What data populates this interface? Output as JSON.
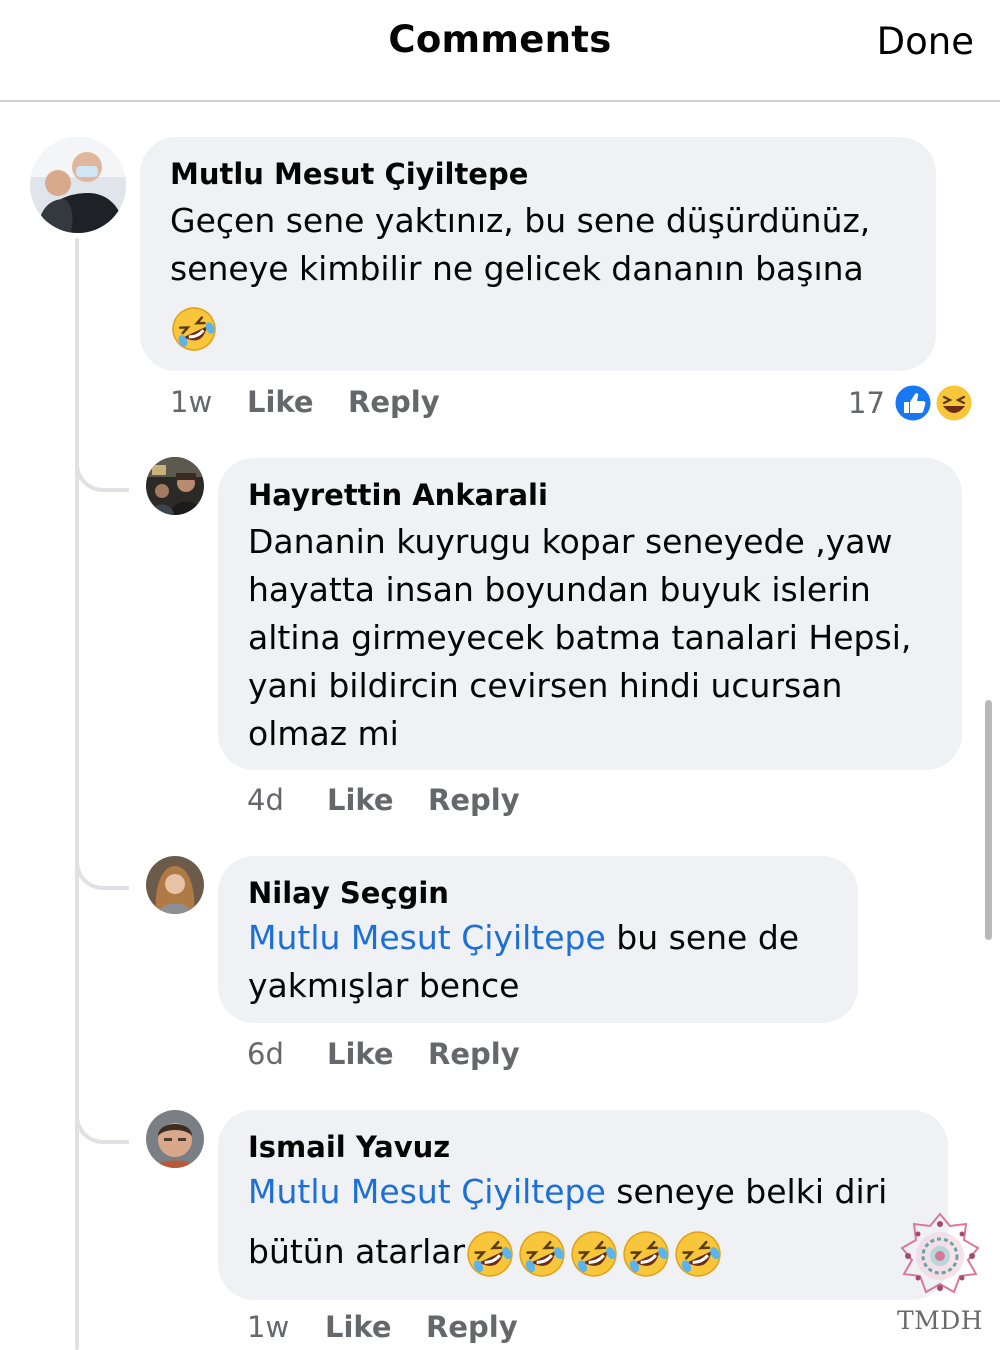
{
  "header": {
    "title": "Comments",
    "done_label": "Done"
  },
  "comments": [
    {
      "author": "Mutlu Mesut Çiyiltepe",
      "lines": [
        "Geçen sene yaktınız, bu sene düşürdünüz,",
        "seneye kimbilir ne gelicek dananın başına"
      ],
      "emoji": "rolling-on-the-floor-laughing",
      "time": "1w",
      "like": "Like",
      "reply": "Reply",
      "reactions": {
        "count": "17",
        "types": [
          "like",
          "laugh"
        ]
      }
    },
    {
      "author": "Hayrettin Ankarali",
      "lines": [
        "Dananin kuyrugu kopar seneyede ,yaw",
        "hayatta insan boyundan buyuk islerin",
        "altina girmeyecek batma tanalari Hepsi,",
        "yani bildircin cevirsen hindi ucursan",
        "olmaz mi"
      ],
      "time": "4d",
      "like": "Like",
      "reply": "Reply"
    },
    {
      "author": "Nilay Seçgin",
      "mention": "Mutlu Mesut Çiyiltepe",
      "line1_rest": " bu sene de",
      "line2": "yakmışlar bence",
      "time": "6d",
      "like": "Like",
      "reply": "Reply"
    },
    {
      "author": "Ismail Yavuz",
      "mention": "Mutlu Mesut Çiyiltepe",
      "line1_rest": " seneye belki diri",
      "line2": "bütün atarlar",
      "emoji": "rolling-on-the-floor-laughing",
      "emoji_count": 5,
      "time": "1w",
      "like": "Like",
      "reply": "Reply"
    }
  ],
  "watermark": {
    "text": "TMDH"
  },
  "colors": {
    "bubble": "#eff1f4",
    "mention": "#1d6fd8",
    "meta": "#65676b",
    "like_blue": "#1877f2",
    "emoji_yellow": "#f7c63a"
  }
}
